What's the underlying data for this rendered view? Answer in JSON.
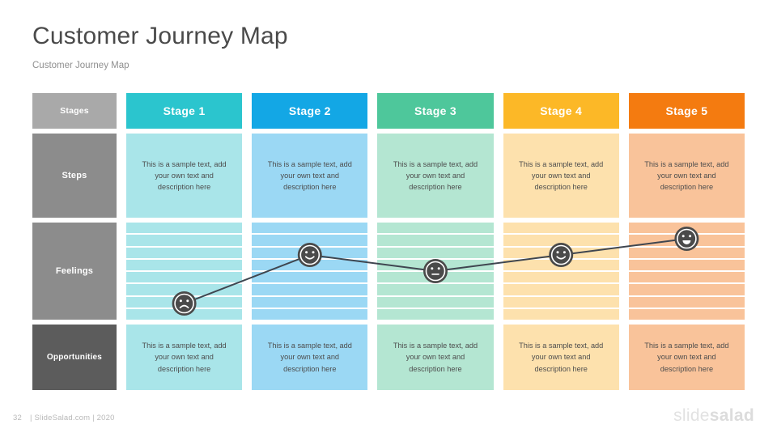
{
  "header": {
    "title": "Customer Journey Map",
    "subtitle": "Customer Journey Map"
  },
  "row_labels": {
    "stages": "Stages",
    "steps": "Steps",
    "feelings": "Feelings",
    "opportunities": "Opportunities"
  },
  "stages": [
    {
      "label": "Stage 1",
      "header_color": "#2bc5ce",
      "tint_color": "#a9e5e9",
      "band_color": "#a9e5e9"
    },
    {
      "label": "Stage 2",
      "header_color": "#13a7e5",
      "tint_color": "#9bd8f4",
      "band_color": "#9bd8f4"
    },
    {
      "label": "Stage 3",
      "header_color": "#4ec79b",
      "tint_color": "#b4e6d2",
      "band_color": "#b4e6d2"
    },
    {
      "label": "Stage 4",
      "header_color": "#fcb827",
      "tint_color": "#fde1ad",
      "band_color": "#fde1ad"
    },
    {
      "label": "Stage 5",
      "header_color": "#f47b10",
      "tint_color": "#f9c39a",
      "band_color": "#f9c39a"
    }
  ],
  "steps_row": [
    "This is a sample text, add your own text and description here",
    "This is a sample text, add your own text and description here",
    "This is a sample text, add your own text and description here",
    "This is a sample text, add your own text and description here",
    "This is a sample text, add your own text and description here"
  ],
  "opportunities_row": [
    "This is a sample text, add your own text and description here",
    "This is a sample text, add your own text and description here",
    "This is a sample text, add your own text and description here",
    "This is a sample text, add your own text and description here",
    "This is a sample text, add your own text and description here"
  ],
  "chart_data": {
    "type": "line",
    "title": "Customer Journey Map",
    "xlabel": "Stages",
    "ylabel": "Feelings",
    "categories": [
      "Stage 1",
      "Stage 2",
      "Stage 3",
      "Stage 4",
      "Stage 5"
    ],
    "series": [
      {
        "name": "Feelings",
        "values": [
          1,
          4,
          3,
          4,
          5
        ],
        "sentiments": [
          "sad",
          "happy",
          "neutral",
          "happy",
          "very-happy"
        ]
      }
    ],
    "ylim": [
      0,
      6
    ],
    "grid": true,
    "legend": "none",
    "marker_color": "#4a4a4a",
    "line_color": "#3f4650"
  },
  "footer": {
    "page_number": "32",
    "credit": "| SlideSalad.com | 2020",
    "logo_light": "slide",
    "logo_bold": "salad"
  }
}
